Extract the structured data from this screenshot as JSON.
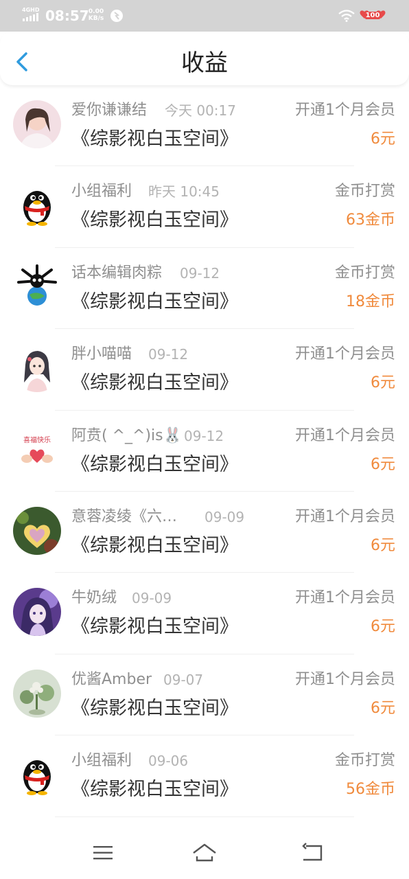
{
  "status_bar": {
    "network": "4GHD",
    "time": "08:57",
    "speed_value": "0.00",
    "speed_unit": "KB/s",
    "battery": "100"
  },
  "header": {
    "title": "收益",
    "back_icon": "chevron-left-icon"
  },
  "colors": {
    "accent": "#2f9bde",
    "amount": "#f08a3c",
    "status_bar_bg": "#d4d4d4"
  },
  "records": [
    {
      "name": "爱你谦谦结",
      "time": "今天 00:17",
      "book": "《综影视白玉空间》",
      "action": "开通1个月会员",
      "amount": "6元",
      "avatar": "photo-avatar"
    },
    {
      "name": "小组福利",
      "time": "昨天 10:45",
      "book": "《综影视白玉空间》",
      "action": "金币打赏",
      "amount": "63金币",
      "avatar": "qq-penguin-avatar"
    },
    {
      "name": "话本编辑肉粽",
      "time": "09-12",
      "book": "《综影视白玉空间》",
      "action": "金币打赏",
      "amount": "18金币",
      "avatar": "cartoon-avatar"
    },
    {
      "name": "胖小喵喵",
      "time": "09-12",
      "book": "《综影视白玉空间》",
      "action": "开通1个月会员",
      "amount": "6元",
      "avatar": "anime-girl-avatar"
    },
    {
      "name": "阿贲( ^_^)is🐰",
      "time": "09-12",
      "book": "《综影视白玉空间》",
      "action": "开通1个月会员",
      "amount": "6元",
      "avatar": "heart-hands-avatar"
    },
    {
      "name": "意蓉凌绫《六…",
      "time": "09-09",
      "book": "《综影视白玉空间》",
      "action": "开通1个月会员",
      "amount": "6元",
      "avatar": "heart-photo-avatar"
    },
    {
      "name": "牛奶绒",
      "time": "09-09",
      "book": "《综影视白玉空间》",
      "action": "开通1个月会员",
      "amount": "6元",
      "avatar": "anime-purple-avatar"
    },
    {
      "name": "优酱Amber",
      "time": "09-07",
      "book": "《综影视白玉空间》",
      "action": "开通1个月会员",
      "amount": "6元",
      "avatar": "flower-avatar"
    },
    {
      "name": "小组福利",
      "time": "09-06",
      "book": "《综影视白玉空间》",
      "action": "金币打赏",
      "amount": "56金币",
      "avatar": "qq-penguin-avatar"
    }
  ],
  "nav_bar": {
    "menu_icon": "menu-icon",
    "home_icon": "home-icon",
    "back_icon": "back-arrow-icon"
  }
}
